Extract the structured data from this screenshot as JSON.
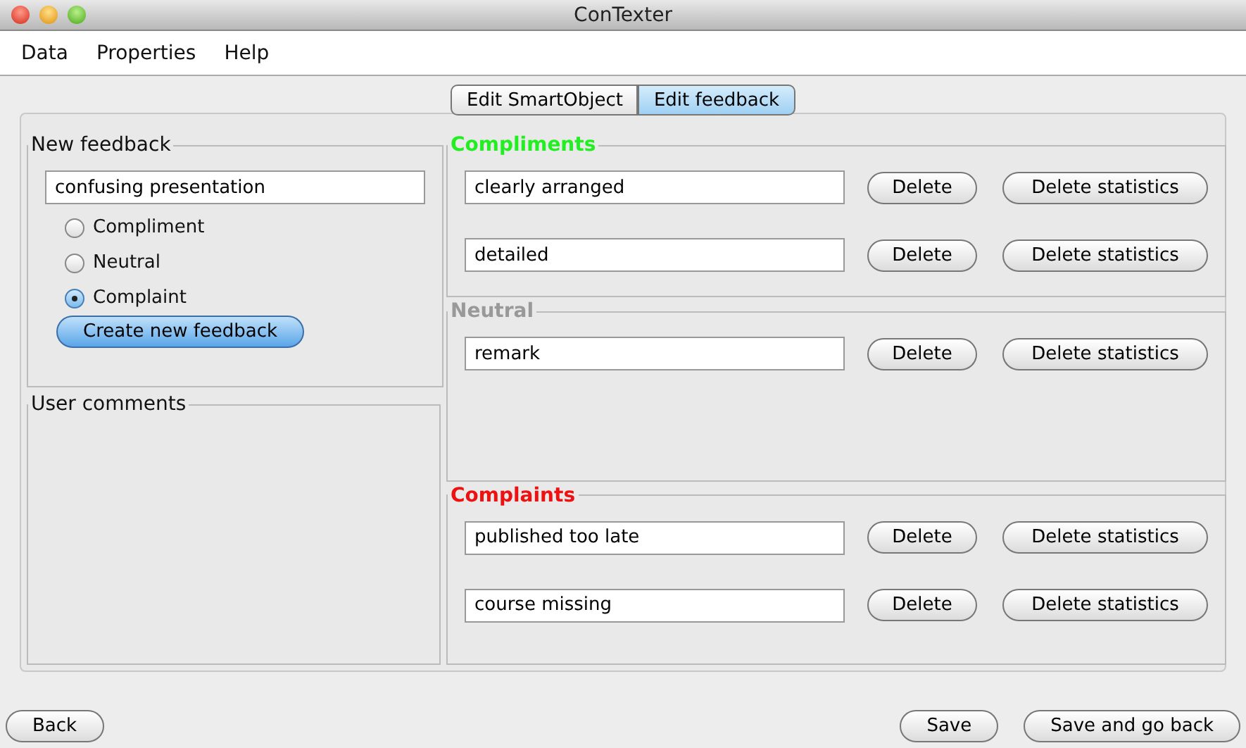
{
  "window": {
    "title": "ConTexter"
  },
  "menu": [
    "Data",
    "Properties",
    "Help"
  ],
  "tabs": [
    {
      "label": "Edit SmartObject",
      "selected": false
    },
    {
      "label": "Edit feedback",
      "selected": true
    }
  ],
  "new_feedback": {
    "title": "New feedback",
    "value": "confusing presentation",
    "options": [
      {
        "label": "Compliment",
        "selected": false
      },
      {
        "label": "Neutral",
        "selected": false
      },
      {
        "label": "Complaint",
        "selected": true
      }
    ],
    "button": "Create new feedback"
  },
  "user_comments": {
    "title": "User comments"
  },
  "groups": [
    {
      "title": "Compliments",
      "color": "#22ee22",
      "items": [
        {
          "value": "clearly arranged",
          "delete": "Delete",
          "delete_statistics": "Delete statistics"
        },
        {
          "value": "detailed",
          "delete": "Delete",
          "delete_statistics": "Delete statistics"
        }
      ]
    },
    {
      "title": "Neutral",
      "color": "#999999",
      "items": [
        {
          "value": "remark",
          "delete": "Delete",
          "delete_statistics": "Delete statistics"
        }
      ]
    },
    {
      "title": "Complaints",
      "color": "#ee1111",
      "items": [
        {
          "value": "published too late",
          "delete": "Delete",
          "delete_statistics": "Delete statistics"
        },
        {
          "value": "course missing",
          "delete": "Delete",
          "delete_statistics": "Delete statistics"
        }
      ]
    }
  ],
  "footer": {
    "back": "Back",
    "save": "Save",
    "save_back": "Save and go back"
  }
}
